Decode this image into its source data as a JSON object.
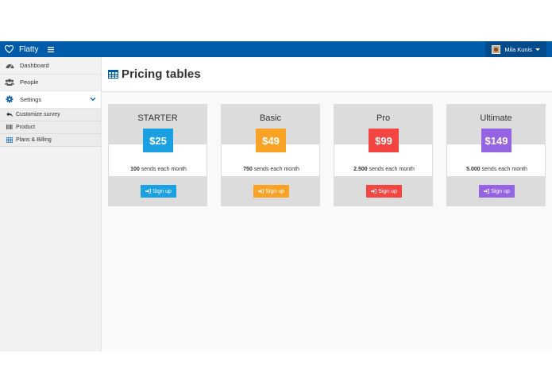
{
  "navbar": {
    "brand": "Flatty",
    "user_name": "Mila Kunis"
  },
  "sidebar": {
    "items": [
      {
        "label": "Dashboard",
        "icon": "dashboard-icon"
      },
      {
        "label": "People",
        "icon": "people-icon"
      },
      {
        "label": "Settings",
        "icon": "gear-icon",
        "active": true
      }
    ],
    "subitems": [
      {
        "label": "Customize survey",
        "icon": "reply-icon"
      },
      {
        "label": "Product",
        "icon": "barcode-icon"
      },
      {
        "label": "Plans & Billing",
        "icon": "table-icon"
      }
    ]
  },
  "page": {
    "title": "Pricing tables",
    "title_icon": "table-icon"
  },
  "plans": [
    {
      "name": "STARTER",
      "price": "$25",
      "sends_count": "100",
      "sends_text": "sends each month",
      "button": "Sign up",
      "color": "#1ba1e2"
    },
    {
      "name": "Basic",
      "price": "$49",
      "sends_count": "750",
      "sends_text": "sends each month",
      "button": "Sign up",
      "color": "#f8a326"
    },
    {
      "name": "Pro",
      "price": "$99",
      "sends_count": "2.500",
      "sends_text": "sends each month",
      "button": "Sign up",
      "color": "#f34541"
    },
    {
      "name": "Ultimate",
      "price": "$149",
      "sends_count": "5.000",
      "sends_text": "sends each month",
      "button": "Sign up",
      "color": "#9564e2"
    }
  ],
  "colors": {
    "navbar": "#005cab",
    "user_menu": "#034b8a",
    "accent": "#005cab"
  }
}
